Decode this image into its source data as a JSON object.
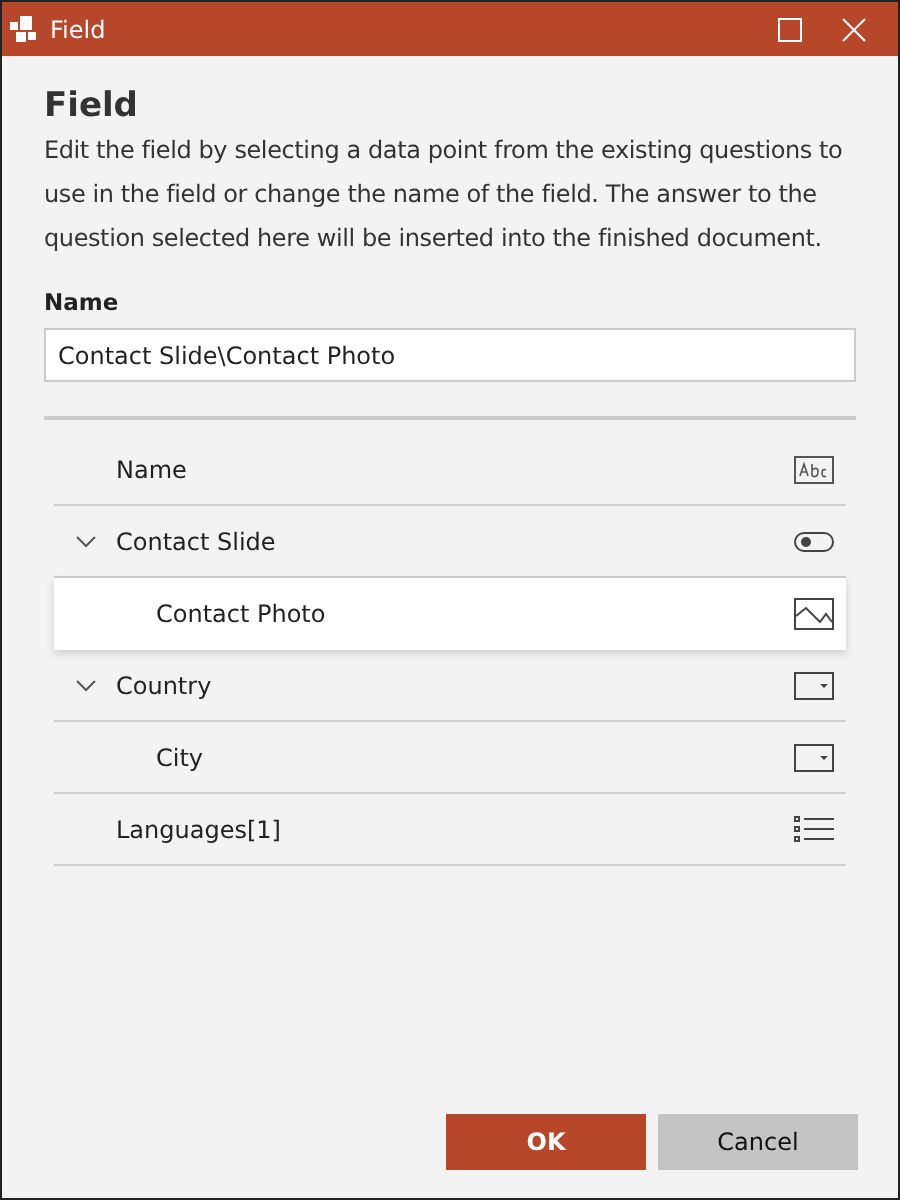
{
  "window": {
    "title": "Field"
  },
  "heading": "Field",
  "description": "Edit the field by selecting a data point from the existing questions to use in the field or change the name of the field. The answer to the question selected here will be inserted into the finished document.",
  "name_field": {
    "label": "Name",
    "value": "Contact Slide\\Contact Photo"
  },
  "tree": [
    {
      "label": "Name",
      "kind": "text",
      "selected": false
    },
    {
      "label": "Contact Slide",
      "kind": "toggle",
      "selected": false,
      "expanded": true,
      "children": [
        {
          "label": "Contact Photo",
          "kind": "image",
          "selected": true
        }
      ]
    },
    {
      "label": "Country",
      "kind": "dropdown",
      "selected": false,
      "expanded": true,
      "children": [
        {
          "label": "City",
          "kind": "dropdown",
          "selected": false
        }
      ]
    },
    {
      "label": "Languages[1]",
      "kind": "list",
      "selected": false
    }
  ],
  "buttons": [
    {
      "label": "OK",
      "kind": "primary"
    },
    {
      "label": "Cancel",
      "kind": "secondary"
    }
  ]
}
